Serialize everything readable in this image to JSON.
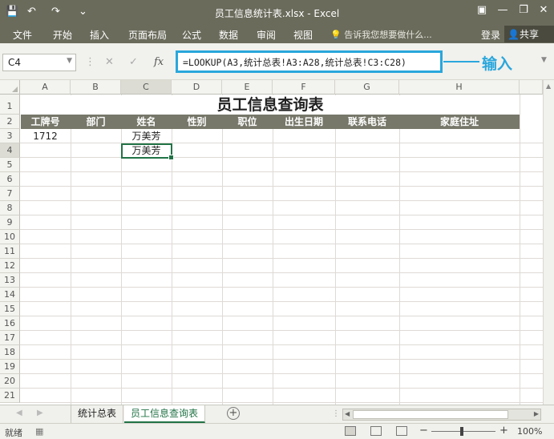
{
  "window": {
    "title": "员工信息统计表.xlsx - Excel",
    "quick_access": [
      "💾",
      "↶",
      "↷",
      "⌄"
    ]
  },
  "ribbon": {
    "tabs": [
      "文件",
      "开始",
      "插入",
      "页面布局",
      "公式",
      "数据",
      "审阅",
      "视图"
    ],
    "tell_me": "告诉我您想要做什么...",
    "login": "登录",
    "share": "共享"
  },
  "formula_bar": {
    "name_box": "C4",
    "formula": "=LOOKUP(A3,统计总表!A3:A28,统计总表!C3:C28)",
    "annotation": "输入"
  },
  "grid": {
    "columns": [
      "A",
      "B",
      "C",
      "D",
      "E",
      "F",
      "G",
      "H"
    ],
    "rows": [
      "1",
      "2",
      "3",
      "4",
      "5",
      "6",
      "7",
      "8",
      "9",
      "10",
      "11",
      "12",
      "13",
      "14",
      "15",
      "16",
      "17",
      "18",
      "19",
      "20",
      "21"
    ],
    "sheet_title": "员工信息查询表",
    "headers": [
      "工牌号",
      "部门",
      "姓名",
      "性别",
      "职位",
      "出生日期",
      "联系电话",
      "家庭住址"
    ],
    "row3": {
      "a": "1712",
      "c": "万美芳"
    },
    "row4": {
      "c": "万美芳"
    }
  },
  "sheets": {
    "tabs": [
      "统计总表",
      "员工信息查询表"
    ],
    "active": 1
  },
  "status": {
    "ready": "就绪",
    "zoom": "100%"
  },
  "colors": {
    "title_bar": "#6b6b5c",
    "header_row": "#77776a",
    "highlight": "#2aa7dc",
    "excel_green": "#217346"
  }
}
